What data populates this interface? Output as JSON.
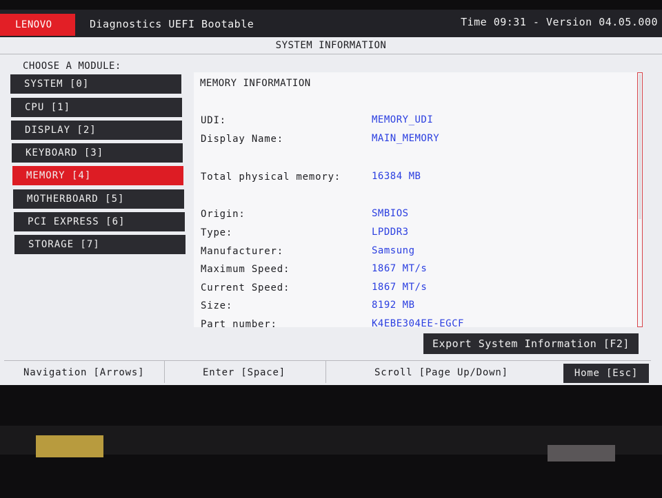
{
  "header": {
    "brand": "LENOVO",
    "app_title": "Diagnostics UEFI Bootable",
    "time_version": "Time 09:31  - Version 04.05.000"
  },
  "page_title": "SYSTEM INFORMATION",
  "sidebar": {
    "label": "CHOOSE A MODULE:",
    "items": [
      {
        "label": "SYSTEM [0]"
      },
      {
        "label": "CPU [1]"
      },
      {
        "label": "DISPLAY [2]"
      },
      {
        "label": "KEYBOARD [3]"
      },
      {
        "label": "MEMORY [4]",
        "active": true
      },
      {
        "label": "MOTHERBOARD [5]"
      },
      {
        "label": "PCI EXPRESS [6]"
      },
      {
        "label": "STORAGE [7]"
      }
    ]
  },
  "content": {
    "title": "MEMORY INFORMATION",
    "rows": [
      {
        "label": "UDI:",
        "value": "MEMORY_UDI"
      },
      {
        "label": "Display Name:",
        "value": "MAIN_MEMORY"
      },
      {
        "label": "Total physical memory:",
        "value": "16384 MB"
      },
      {
        "label": "Origin:",
        "value": "SMBIOS"
      },
      {
        "label": "Type:",
        "value": "LPDDR3"
      },
      {
        "label": "Manufacturer:",
        "value": "Samsung"
      },
      {
        "label": "Maximum Speed:",
        "value": "1867 MT/s"
      },
      {
        "label": "Current Speed:",
        "value": "1867 MT/s"
      },
      {
        "label": "Size:",
        "value": "8192 MB"
      },
      {
        "label": "Part number:",
        "value": "K4EBE304EE-EGCF"
      }
    ]
  },
  "export_button": "Export System Information [F2]",
  "footer": {
    "navigation": "Navigation [Arrows]",
    "enter": "Enter [Space]",
    "scroll": "Scroll [Page Up/Down]",
    "home": "Home [Esc]"
  },
  "colors": {
    "accent": "#e21f26",
    "value_text": "#2a3ee0",
    "button_bg": "#2b2b30",
    "screen_bg": "#ecedf1"
  }
}
